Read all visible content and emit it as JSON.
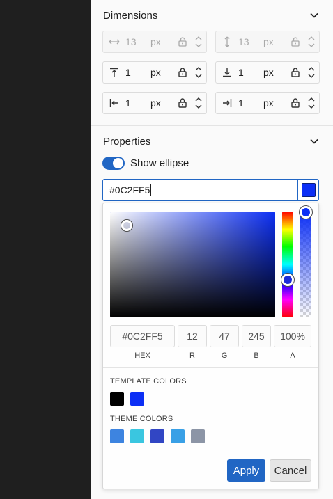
{
  "sections": {
    "dimensions_title": "Dimensions",
    "properties_title": "Properties"
  },
  "dimensions": [
    {
      "icon": "width-arrows-icon",
      "value": "13",
      "unit": "px",
      "disabled": true
    },
    {
      "icon": "height-arrows-icon",
      "value": "13",
      "unit": "px",
      "disabled": true
    },
    {
      "icon": "align-top-icon",
      "value": "1",
      "unit": "px",
      "disabled": false
    },
    {
      "icon": "align-bottom-icon",
      "value": "1",
      "unit": "px",
      "disabled": false
    },
    {
      "icon": "align-left-icon",
      "value": "1",
      "unit": "px",
      "disabled": false
    },
    {
      "icon": "align-right-icon",
      "value": "1",
      "unit": "px",
      "disabled": false
    }
  ],
  "properties": {
    "toggle_label": "Show ellipse",
    "toggle_on": true,
    "hex_value": "#0C2FF5"
  },
  "picker": {
    "hex": "#0C2FF5",
    "r": "12",
    "g": "47",
    "b": "245",
    "a": "100",
    "a_unit": "%",
    "labels": {
      "hex": "HEX",
      "r": "R",
      "g": "G",
      "b": "B",
      "a": "A"
    },
    "template_title": "TEMPLATE COLORS",
    "theme_title": "THEME COLORS",
    "template_colors": [
      "#000000",
      "#0c2ff5"
    ],
    "theme_colors": [
      "#3d84e0",
      "#3ac6e0",
      "#3146c4",
      "#39a0e6",
      "#8c95a6"
    ],
    "apply_label": "Apply",
    "cancel_label": "Cancel"
  },
  "colors": {
    "accent": "#2166c4",
    "selected": "#0c2ff5"
  }
}
